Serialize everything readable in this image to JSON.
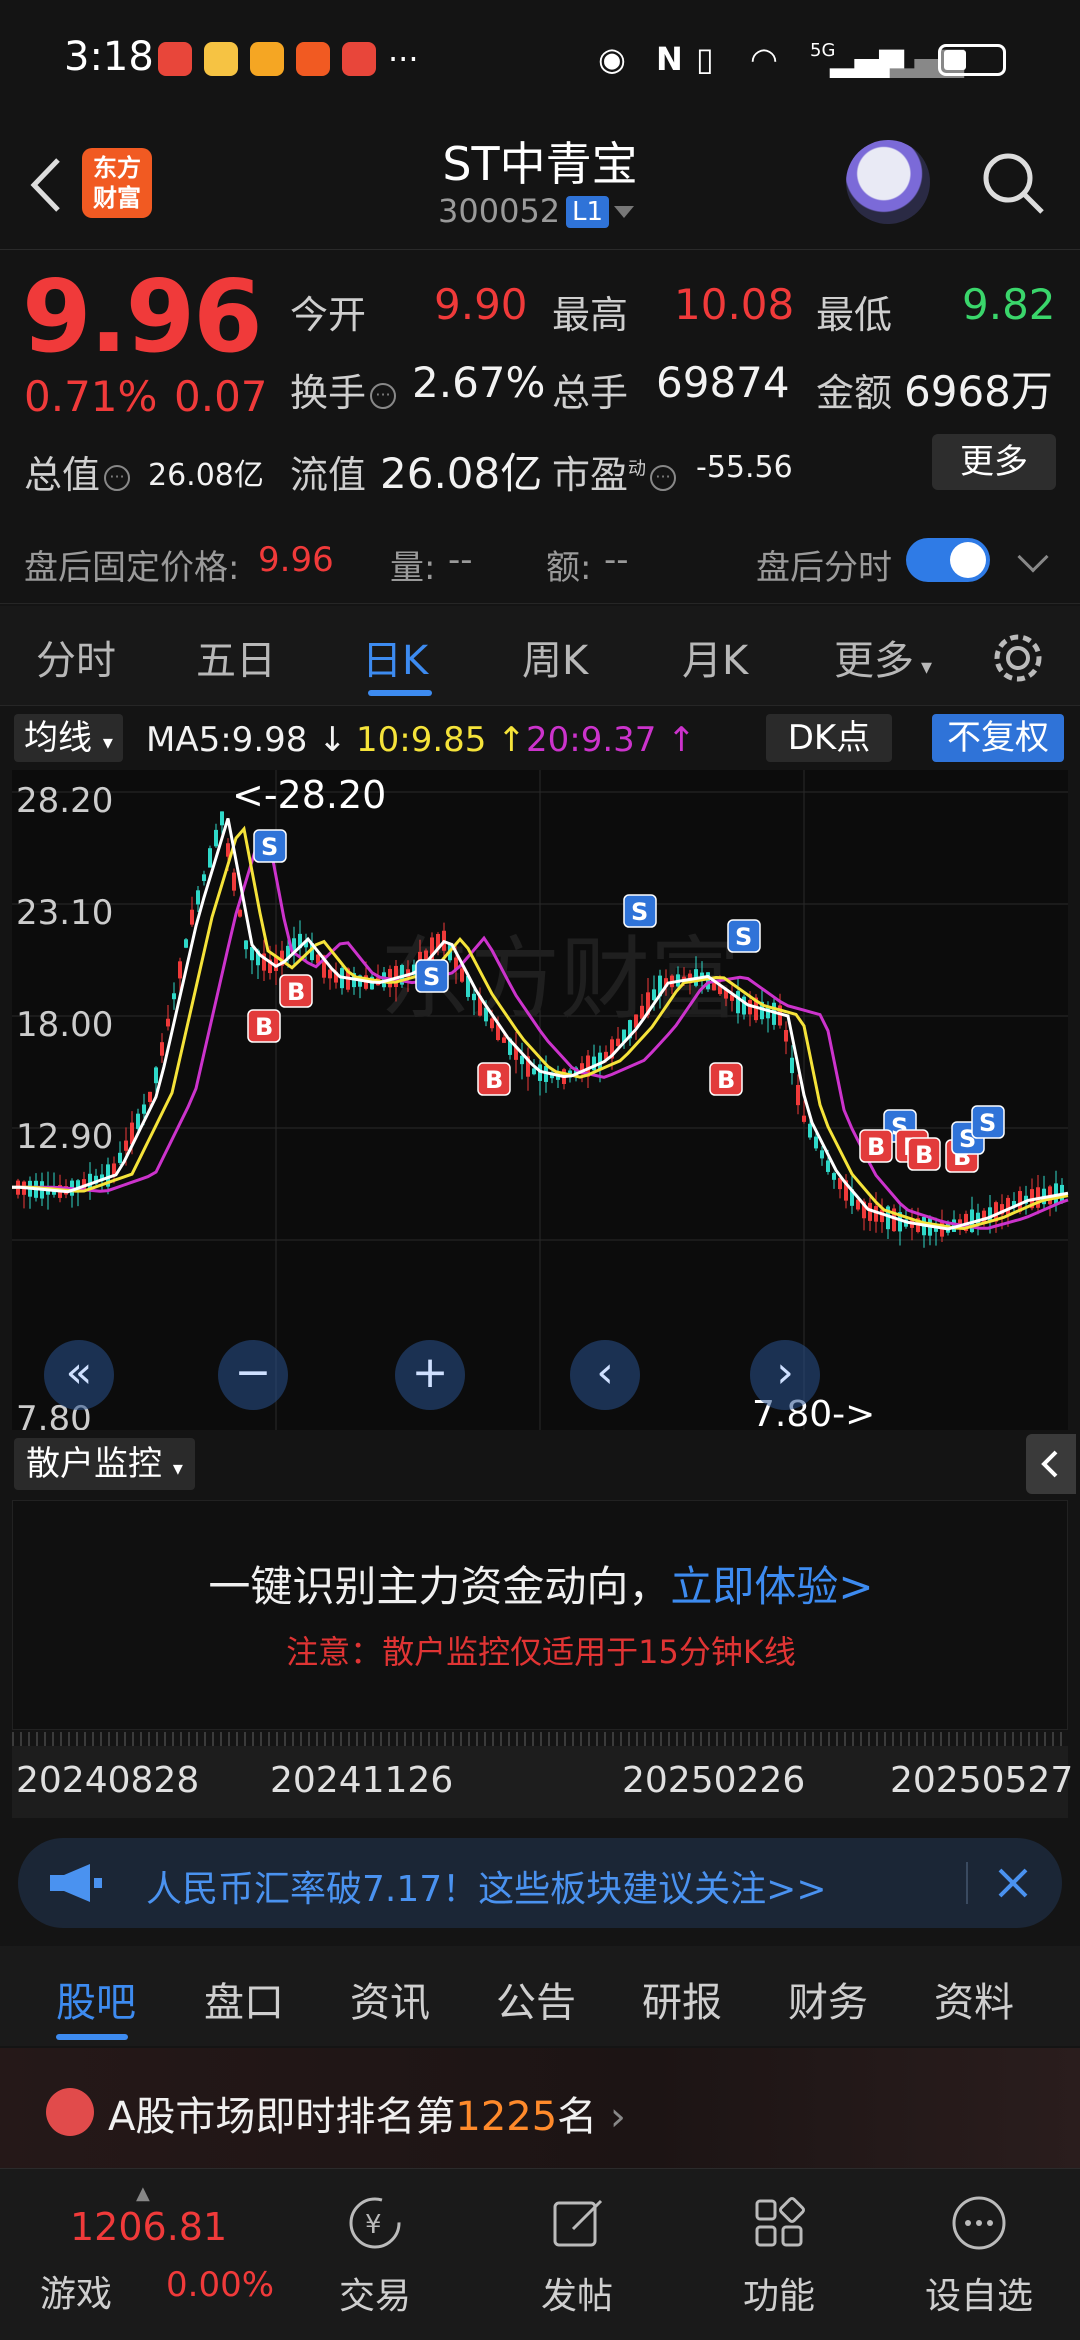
{
  "status_bar": {
    "time": "3:18",
    "more": "···",
    "network": "5G"
  },
  "header": {
    "logo": "东方财富",
    "stock_name": "ST中青宝",
    "stock_code": "300052",
    "level": "L1"
  },
  "quote": {
    "price": "9.96",
    "change_pct": "0.71%",
    "change_abs": "0.07",
    "open_label": "今开",
    "open": "9.90",
    "high_label": "最高",
    "high": "10.08",
    "low_label": "最低",
    "low": "9.82",
    "turnover_label": "换手",
    "turnover": "2.67%",
    "volume_label": "总手",
    "volume": "69874",
    "amount_label": "金额",
    "amount": "6968万",
    "mcap_label": "总值",
    "mcap": "26.08亿",
    "float_label": "流值",
    "float": "26.08亿",
    "pe_label": "市盈",
    "pe_sup": "动",
    "pe": "-55.56",
    "more": "更多"
  },
  "after_hours": {
    "label": "盘后固定价格:",
    "price": "9.96",
    "vol_label": "量:",
    "vol": "--",
    "amt_label": "额:",
    "amt": "--",
    "toggle_label": "盘后分时",
    "toggle_on": true
  },
  "period_tabs": [
    "分时",
    "五日",
    "日K",
    "周K",
    "月K",
    "更多"
  ],
  "active_period": "日K",
  "ma_row": {
    "avg_label": "均线",
    "ma5": "MA5:9.98",
    "ma10": "10:9.85",
    "ma20": "20:9.37",
    "dk": "DK点",
    "fq": "不复权"
  },
  "chart_data": {
    "type": "candlestick",
    "y_ticks": [
      "28.20",
      "23.10",
      "18.00",
      "12.90",
      "7.80"
    ],
    "ylim": [
      7.8,
      28.2
    ],
    "high_marker": "<-28.20",
    "low_marker": "7.80->",
    "dates": [
      "20240828",
      "20241126",
      "20250226",
      "20250527"
    ],
    "colors": {
      "ma5": "#ffffff",
      "ma10": "#f5e33a",
      "ma20": "#cc33cc",
      "up": "#f03a3a",
      "down": "#2fd9c9"
    }
  },
  "retail": {
    "select": "散户监控",
    "cta": "一键识别主力资金动向，",
    "cta_link": "立即体验>",
    "note": "注意：散户监控仅适用于15分钟K线"
  },
  "news": {
    "text": "人民币汇率破7.17！这些板块建议关注>>"
  },
  "info_tabs": [
    "股吧",
    "盘口",
    "资讯",
    "公告",
    "研报",
    "财务",
    "资料"
  ],
  "ranking": {
    "prefix": "A股市场即时排名第",
    "rank": "1225",
    "suffix": "名"
  },
  "bottom_nav": {
    "index_value": "1206.81",
    "index_name": "游戏",
    "index_change": "0.00%",
    "items": [
      "交易",
      "发帖",
      "功能",
      "设自选"
    ]
  }
}
